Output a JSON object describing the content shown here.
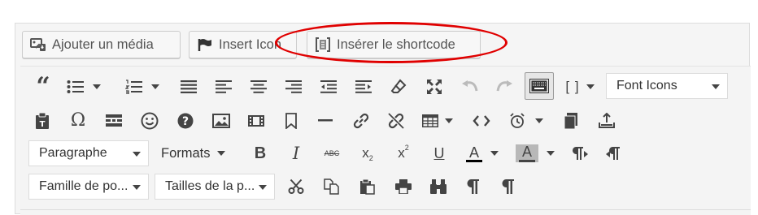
{
  "media_buttons": {
    "add_media": "Ajouter un média",
    "insert_icon": "Insert Icon",
    "insert_shortcode": "Insérer le shortcode"
  },
  "toolbar_row1": {
    "font_icons_select": "Font Icons",
    "shortcode_bracket": "[ ]"
  },
  "toolbar_row3": {
    "paragraph_select": "Paragraphe",
    "formats_menu": "Formats",
    "bold": "B",
    "italic": "I",
    "strikethrough": "ABC",
    "subscript": "x",
    "subscript_mark": "2",
    "superscript": "x",
    "superscript_mark": "2",
    "underline": "U",
    "text_color": "A",
    "background_color": "A"
  },
  "toolbar_row4": {
    "font_family_select": "Famille de po...",
    "font_size_select": "Tailles de la p..."
  },
  "colors": {
    "highlight_ellipse": "#e00000",
    "text_color_bar": "#000000",
    "background_color_swatch": "#b8b8b8"
  },
  "icons": {
    "add_media": "media-icon",
    "insert_icon": "flag-icon",
    "insert_shortcode": "shortcode-icon"
  }
}
